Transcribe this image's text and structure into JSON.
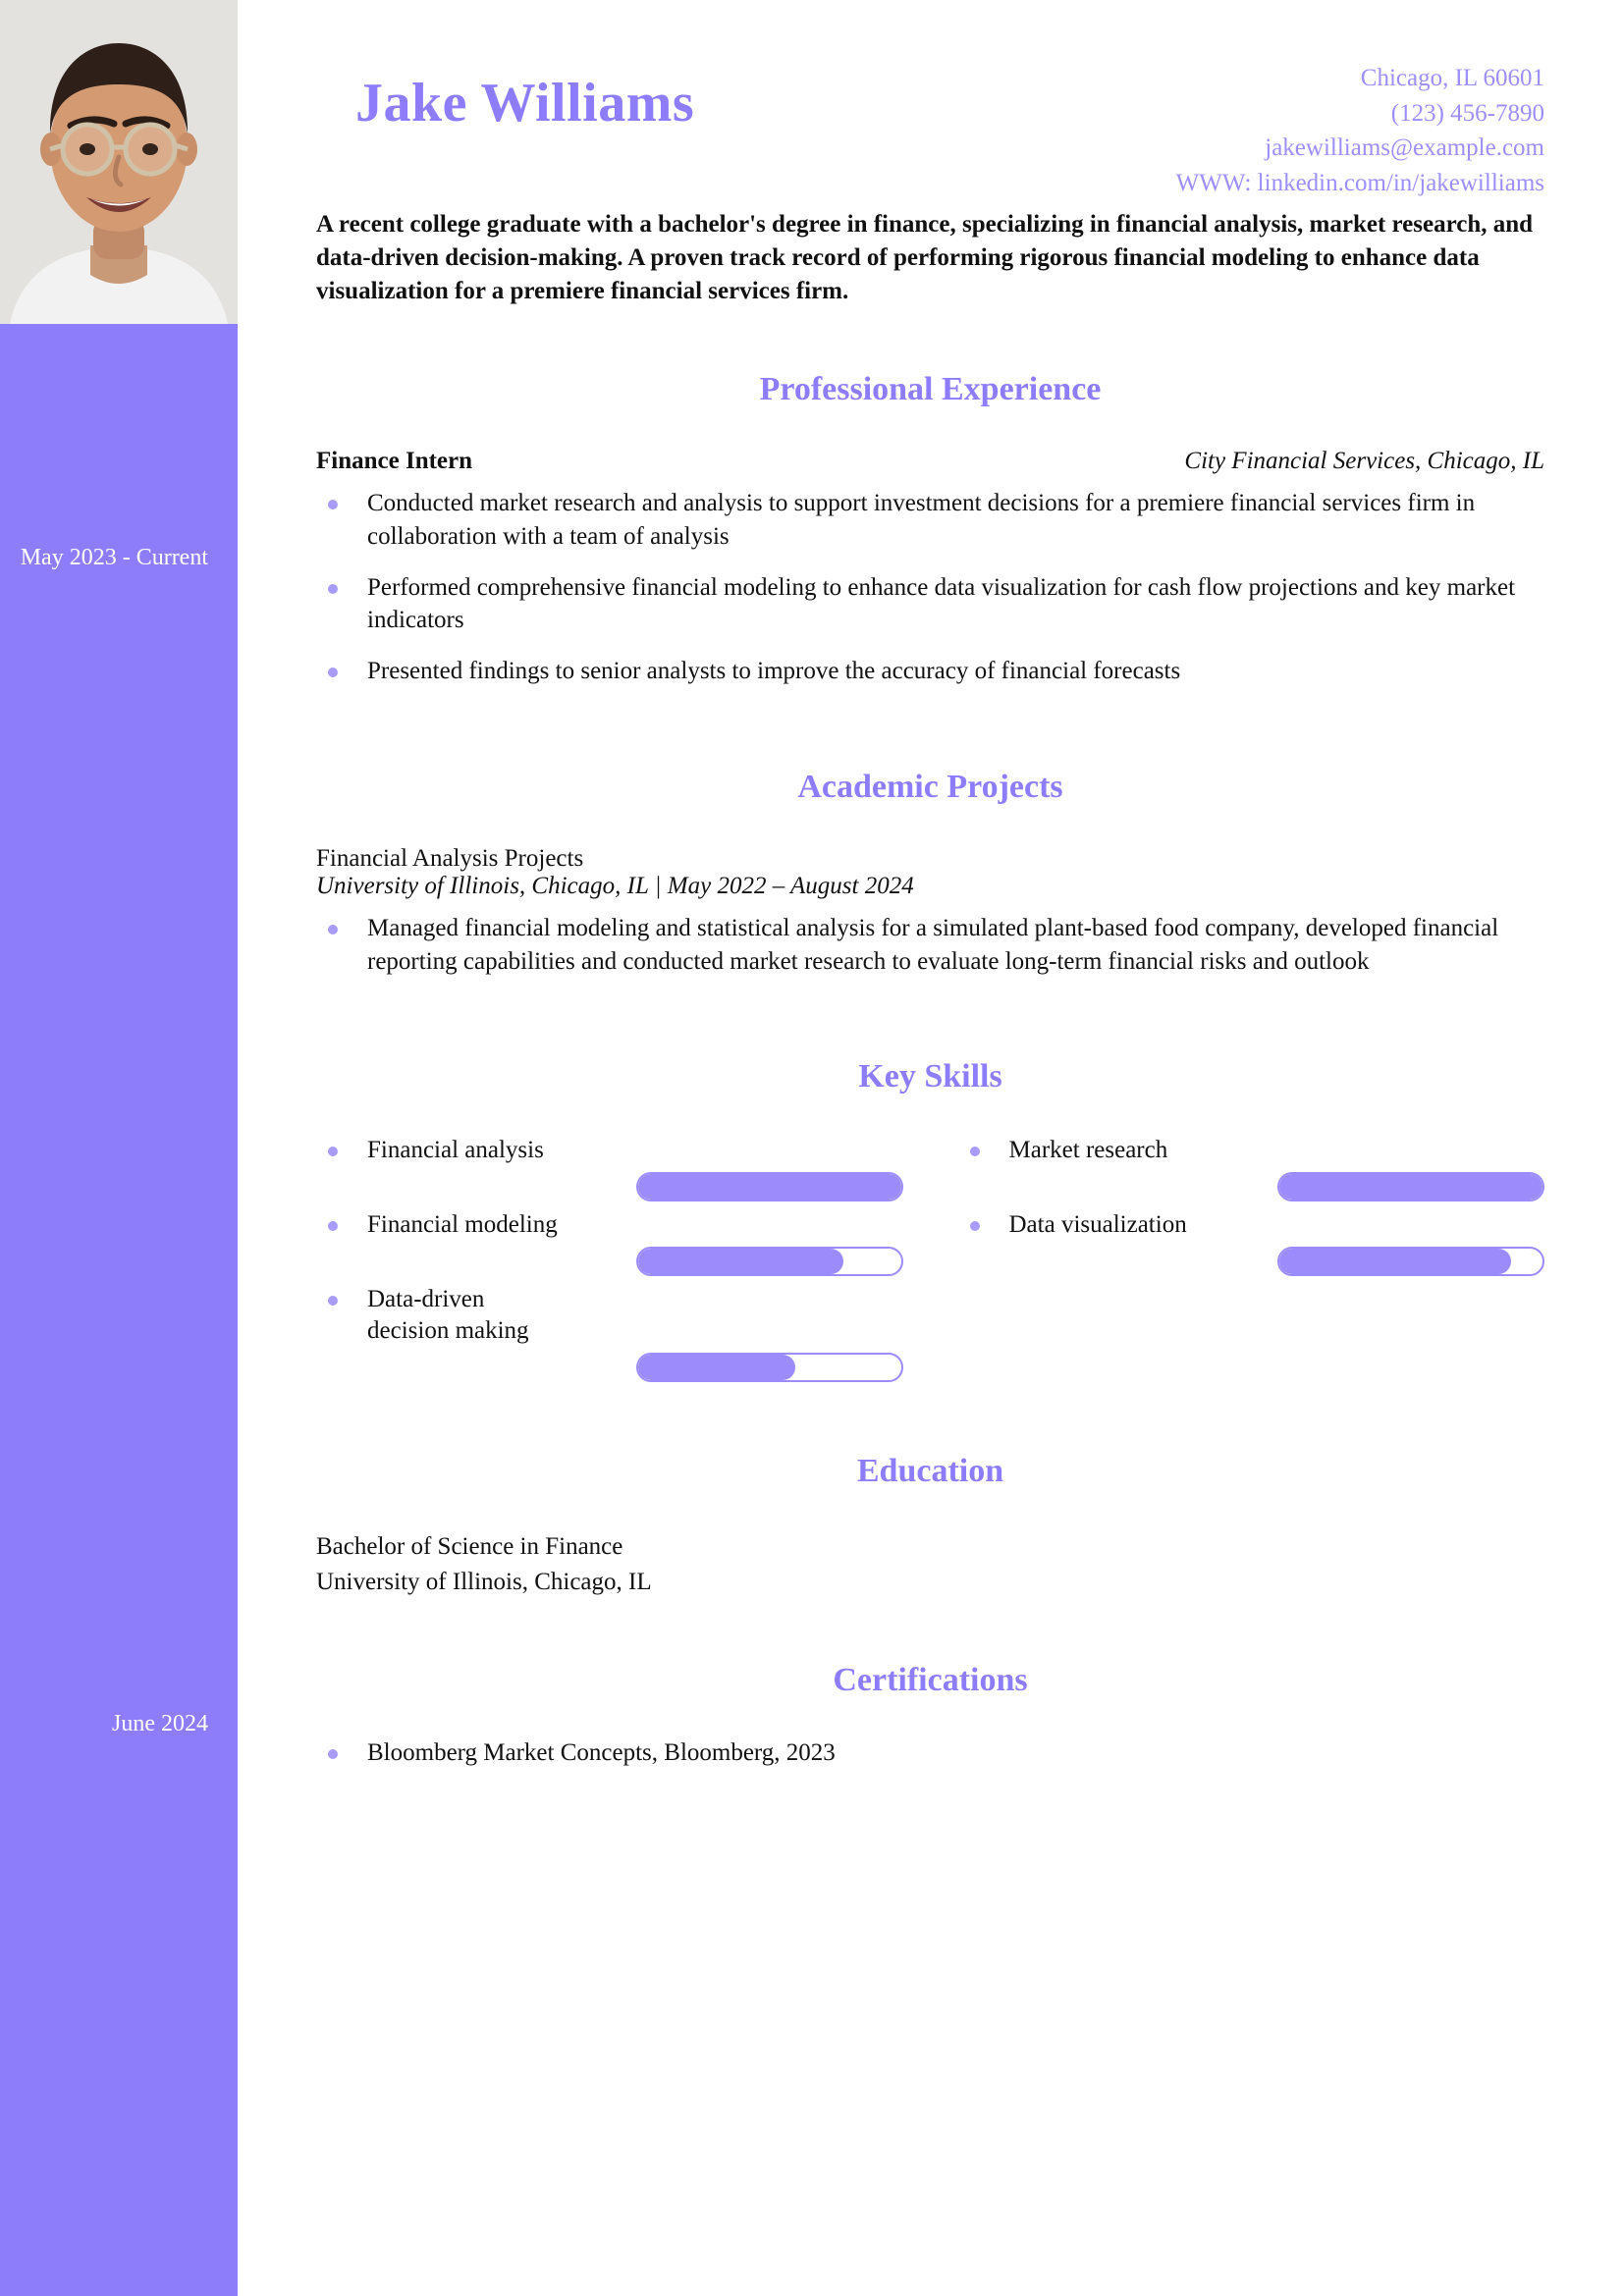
{
  "accent": "#8d7dfa",
  "accent_light": "#9d8ffb",
  "bullet_color": "#a99bfb",
  "header": {
    "name": "Jake Williams",
    "contact": {
      "location": "Chicago, IL 60601",
      "phone": "(123) 456-7890",
      "email": "jakewilliams@example.com",
      "website": "WWW: linkedin.com/in/jakewilliams"
    }
  },
  "summary": "A recent college graduate with a bachelor's degree in finance, specializing in financial analysis, market research, and data-driven decision-making. A proven track record of performing rigorous financial modeling to enhance data visualization for a premiere financial services firm.",
  "sections": {
    "experience": {
      "title": "Professional Experience",
      "date": "May 2023 - Current",
      "job_title": "Finance Intern",
      "company": "City Financial Services, Chicago, IL",
      "bullets": [
        "Conducted market research and analysis to support investment decisions for a premiere financial services firm in collaboration with a team of analysis",
        "Performed comprehensive financial modeling to enhance data visualization for cash flow projections and key market indicators",
        "Presented findings to senior analysts to improve the accuracy of financial forecasts"
      ]
    },
    "academic": {
      "title": "Academic Projects",
      "project_name": "Financial Analysis Projects",
      "project_meta": "University of Illinois, Chicago, IL | May 2022 – August 2024",
      "bullets": [
        "Managed financial modeling and statistical analysis for a simulated plant-based food company, developed financial reporting capabilities and conducted market research to evaluate long-term financial risks and outlook"
      ]
    },
    "skills": {
      "title": "Key Skills",
      "items": [
        {
          "label": "Financial analysis",
          "level": 100
        },
        {
          "label": "Market research",
          "level": 100
        },
        {
          "label": "Financial modeling",
          "level": 78
        },
        {
          "label": "Data visualization",
          "level": 88
        },
        {
          "label": "Data-driven decision making",
          "level": 60
        }
      ]
    },
    "education": {
      "title": "Education",
      "date": "June 2024",
      "degree": "Bachelor of Science in Finance",
      "school": "University of Illinois, Chicago, IL"
    },
    "certifications": {
      "title": "Certifications",
      "items": [
        "Bloomberg Market Concepts, Bloomberg, 2023"
      ]
    }
  }
}
